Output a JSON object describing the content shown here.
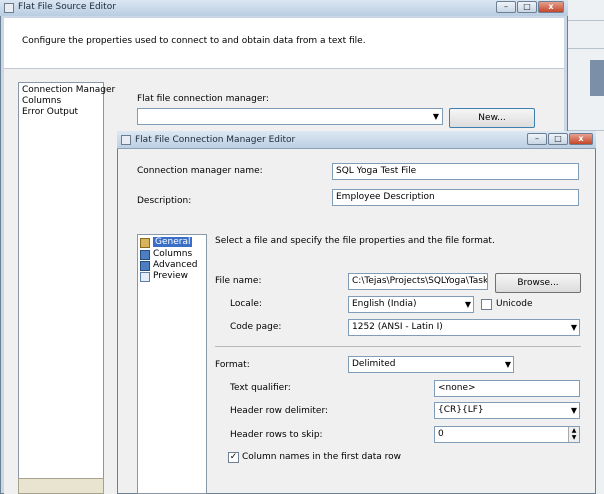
{
  "background_window": {
    "title": "Flat File Source Editor",
    "description": "Configure the properties used to connect to and obtain data from a text file.",
    "pages": [
      "Connection Manager",
      "Columns",
      "Error Output"
    ],
    "connection_manager_label": "Flat file connection manager:",
    "new_button": "New..."
  },
  "dialog": {
    "title": "Flat File Connection Manager Editor",
    "name_label": "Connection manager name:",
    "name_value": "SQL Yoga Test File",
    "description_label": "Description:",
    "description_value": "Employee Description",
    "nav_items": [
      "General",
      "Columns",
      "Advanced",
      "Preview"
    ],
    "instructions": "Select a file and specify the file properties and the file format.",
    "file_name_label": "File name:",
    "file_name_value": "C:\\Tejas\\Projects\\SQLYoga\\TasksTuto",
    "browse_button": "Browse...",
    "locale_label": "Locale:",
    "locale_value": "English (India)",
    "unicode_label": "Unicode",
    "code_page_label": "Code page:",
    "code_page_value": "1252  (ANSI - Latin I)",
    "format_label": "Format:",
    "format_value": "Delimited",
    "text_qualifier_label": "Text qualifier:",
    "text_qualifier_value": "<none>",
    "header_row_delimiter_label": "Header row delimiter:",
    "header_row_delimiter_value": "{CR}{LF}",
    "header_rows_to_skip_label": "Header rows to skip:",
    "header_rows_to_skip_value": "0",
    "column_names_label": "Column names in the first data row",
    "column_names_checked": true
  }
}
